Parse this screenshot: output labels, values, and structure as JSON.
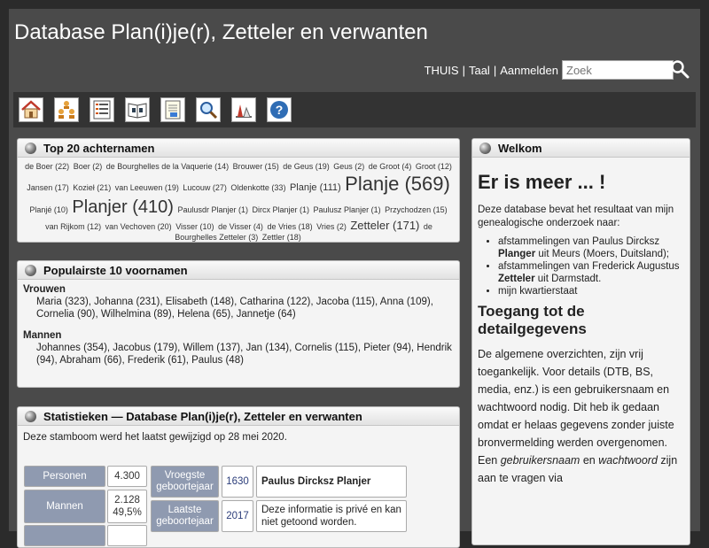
{
  "header": {
    "title": "Database Plan(i)je(r), Zetteler en verwanten",
    "nav": {
      "home": "THUIS",
      "lang": "Taal",
      "login": "Aanmelden",
      "sep": "|"
    },
    "search": {
      "placeholder": "Zoek",
      "value": ""
    }
  },
  "toolbar": {
    "icons": [
      "home-icon",
      "family-tree-icon",
      "list-icon",
      "book-icon",
      "document-icon",
      "search-icon",
      "chart-icon",
      "help-icon"
    ]
  },
  "surnames": {
    "title": "Top 20 achternamen",
    "items": [
      {
        "text": "de Boer (22)",
        "size": "s-sm"
      },
      {
        "text": "Boer (2)",
        "size": "s-sm"
      },
      {
        "text": "de Bourghelles de la Vaquerie (14)",
        "size": "s-sm"
      },
      {
        "text": "Brouwer (15)",
        "size": "s-sm"
      },
      {
        "text": "de Geus (19)",
        "size": "s-sm"
      },
      {
        "text": "Geus (2)",
        "size": "s-sm"
      },
      {
        "text": "de Groot (4)",
        "size": "s-sm"
      },
      {
        "text": "Groot (12)",
        "size": "s-sm"
      },
      {
        "text": "Jansen (17)",
        "size": "s-sm"
      },
      {
        "text": "Kozieł (21)",
        "size": "s-sm"
      },
      {
        "text": "van Leeuwen (19)",
        "size": "s-sm"
      },
      {
        "text": "Lucouw (27)",
        "size": "s-sm"
      },
      {
        "text": "Oldenkotte (33)",
        "size": "s-sm"
      },
      {
        "text": "Planje (111)",
        "size": "s-md"
      },
      {
        "text": "Planje (569)",
        "size": "s-xxl"
      },
      {
        "text": "Planjé (10)",
        "size": "s-sm"
      },
      {
        "text": "Planjer (410)",
        "size": "s-xl"
      },
      {
        "text": "Paulusdr Planjer (1)",
        "size": "s-sm"
      },
      {
        "text": "Dircx Planjer (1)",
        "size": "s-sm"
      },
      {
        "text": "Paulusz Planjer (1)",
        "size": "s-sm"
      },
      {
        "text": "Przychodzen (15)",
        "size": "s-sm"
      },
      {
        "text": "van Rijkom (12)",
        "size": "s-sm"
      },
      {
        "text": "van Vechoven (20)",
        "size": "s-sm"
      },
      {
        "text": "Visser (10)",
        "size": "s-sm"
      },
      {
        "text": "de Visser (4)",
        "size": "s-sm"
      },
      {
        "text": "de Vries (18)",
        "size": "s-sm"
      },
      {
        "text": "Vries (2)",
        "size": "s-sm"
      },
      {
        "text": "Zetteler (171)",
        "size": "s-lg"
      },
      {
        "text": "de Bourghelles Zetteler (3)",
        "size": "s-sm"
      },
      {
        "text": "Zettler (18)",
        "size": "s-sm"
      }
    ]
  },
  "firstnames": {
    "title": "Populairste 10 voornamen",
    "women_label": "Vrouwen",
    "women": "Maria (323), Johanna (231), Elisabeth (148), Catharina (122), Jacoba (115), Anna (109), Cornelia (90), Wilhelmina (89), Helena (65), Jannetje (64)",
    "men_label": "Mannen",
    "men": "Johannes (354), Jacobus (179), Willem (137), Jan (134), Cornelis (115), Pieter (94), Hendrik (94), Abraham (66), Frederik (61), Paulus (48)"
  },
  "stats": {
    "title": "Statistieken — Database Plan(i)je(r), Zetteler en verwanten",
    "intro": "Deze stamboom werd het laatst gewijzigd op 28 mei 2020.",
    "persons_label": "Personen",
    "persons_value": "4.300",
    "men_label": "Mannen",
    "men_value": "2.128",
    "men_pct": "49,5%",
    "earliest_label": "Vroegste geboortejaar",
    "earliest_year": "1630",
    "earliest_name": "Paulus Dircksz Planjer",
    "latest_label": "Laatste geboortejaar",
    "latest_year": "2017",
    "latest_text": "Deze informatie is privé en kan niet getoond worden."
  },
  "welcome": {
    "title": "Welkom",
    "heading": "Er is meer ... !",
    "intro": "Deze database bevat het resultaat van mijn genealogische onderzoek naar:",
    "li1_a": "afstammelingen van  Paulus Dircksz ",
    "li1_b": "Planger",
    "li1_c": " uit Meurs (Moers, Duitsland);",
    "li2_a": "afstammelingen van Frederick Augustus ",
    "li2_b": "Zetteler",
    "li2_c": " uit Darmstadt.",
    "li3": "mijn kwartierstaat",
    "heading2": "Toegang tot de detailgegevens",
    "body_a": "De algemene overzichten, zijn vrij toegankelijk. Voor details (DTB, BS, media, enz.) is een gebruikersnaam en wachtwoord nodig. Dit heb ik gedaan omdat er helaas gegevens zonder juiste bronvermelding werden overgenomen. Een ",
    "body_b": "gebruikersnaam",
    "body_c": " en ",
    "body_d": "wachtwoord",
    "body_e": " zijn aan te vragen via"
  }
}
